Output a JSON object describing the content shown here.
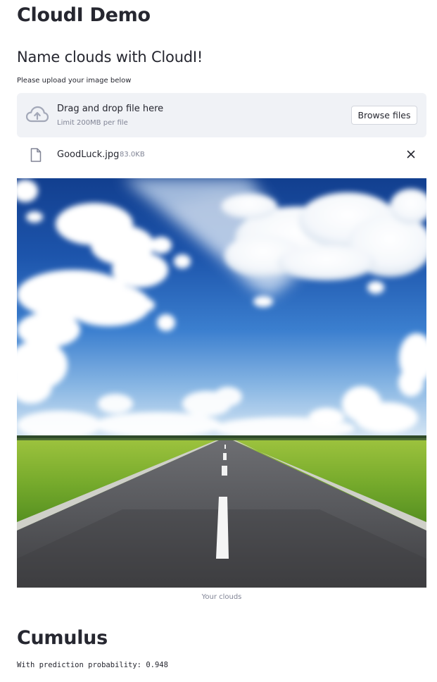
{
  "app": {
    "title": "CloudI Demo",
    "subheader": "Name clouds with CloudI!"
  },
  "uploader": {
    "label": "Please upload your image below",
    "drop_title": "Drag and drop file here",
    "limit_text": "Limit 200MB per file",
    "browse_label": "Browse files",
    "upload_icon": "cloud-upload-icon"
  },
  "uploaded_file": {
    "name": "GoodLuck.jpg",
    "size": "83.0KB",
    "file_icon": "file-icon",
    "remove_icon": "close-icon"
  },
  "image": {
    "caption": "Your clouds"
  },
  "result": {
    "label": "Cumulus",
    "probability_prefix": "With prediction probability:",
    "probability_value": "0.948"
  },
  "colors": {
    "text": "#262730",
    "muted": "#808495",
    "dropzone_bg": "#f0f2f6",
    "sky_top": "#1a4fa3",
    "grass": "#6fa52a",
    "road": "#4a4a4c"
  }
}
